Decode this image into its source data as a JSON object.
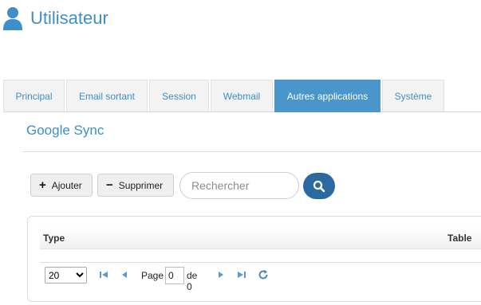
{
  "header": {
    "title": "Utilisateur",
    "icon": "user-icon"
  },
  "tabs": [
    {
      "label": "Principal",
      "active": false
    },
    {
      "label": "Email sortant",
      "active": false
    },
    {
      "label": "Session",
      "active": false
    },
    {
      "label": "Webmail",
      "active": false
    },
    {
      "label": "Autres applications",
      "active": true
    },
    {
      "label": "Système",
      "active": false
    }
  ],
  "section": {
    "title": "Google Sync"
  },
  "toolbar": {
    "add_label": "Ajouter",
    "add_icon": "plus-icon",
    "delete_label": "Supprimer",
    "delete_icon": "minus-icon",
    "search_placeholder": "Rechercher",
    "search_value": "",
    "search_icon": "search-icon"
  },
  "grid": {
    "columns": [
      "Type",
      "Table"
    ],
    "rows": []
  },
  "pager": {
    "page_size": "20",
    "page_size_options": [
      "20"
    ],
    "page_label": "Page",
    "current_page": "0",
    "of_label": "de 0"
  },
  "colors": {
    "accent": "#3d8ec9",
    "active_tab": "#4a95c9",
    "search_button": "#2a6aa1"
  }
}
